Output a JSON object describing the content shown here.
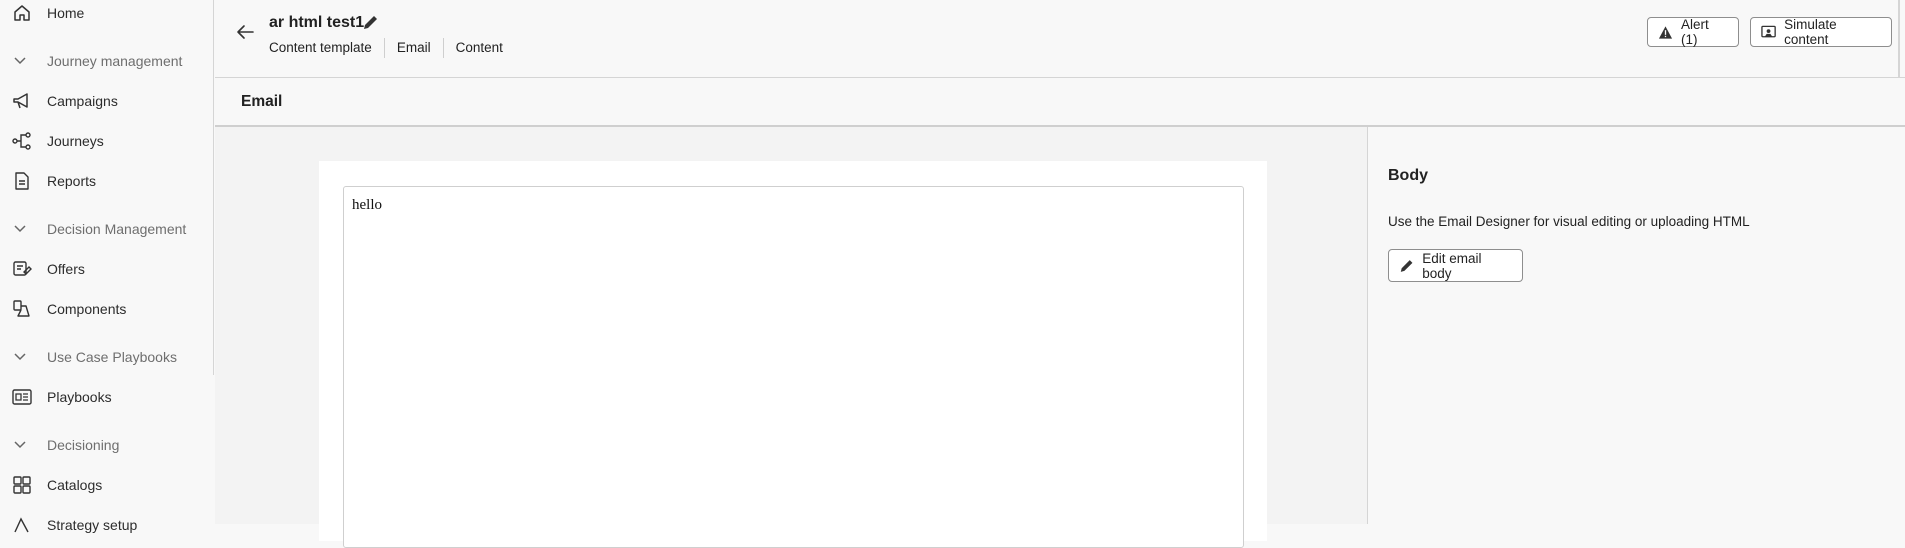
{
  "sidebar": {
    "items": [
      {
        "kind": "item",
        "label": "Home",
        "icon": "home-icon"
      },
      {
        "kind": "section",
        "label": "Journey management"
      },
      {
        "kind": "item",
        "label": "Campaigns",
        "icon": "megaphone-icon"
      },
      {
        "kind": "item",
        "label": "Journeys",
        "icon": "journey-icon"
      },
      {
        "kind": "item",
        "label": "Reports",
        "icon": "report-icon"
      },
      {
        "kind": "section",
        "label": "Decision Management"
      },
      {
        "kind": "item",
        "label": "Offers",
        "icon": "offers-icon"
      },
      {
        "kind": "item",
        "label": "Components",
        "icon": "components-icon"
      },
      {
        "kind": "section",
        "label": "Use Case Playbooks"
      },
      {
        "kind": "item",
        "label": "Playbooks",
        "icon": "playbooks-icon"
      },
      {
        "kind": "section",
        "label": "Decisioning"
      },
      {
        "kind": "item",
        "label": "Catalogs",
        "icon": "catalogs-icon"
      },
      {
        "kind": "item",
        "label": "Strategy setup",
        "icon": "strategy-icon"
      }
    ]
  },
  "header": {
    "title": "ar html test1",
    "breadcrumbs": [
      "Content template",
      "Email",
      "Content"
    ],
    "alert_label": "Alert (1)",
    "simulate_label": "Simulate content"
  },
  "section": {
    "title": "Email"
  },
  "preview": {
    "text": "hello"
  },
  "panel": {
    "heading": "Body",
    "description": "Use the Email Designer for visual editing or uploading HTML",
    "edit_label": "Edit email body"
  }
}
